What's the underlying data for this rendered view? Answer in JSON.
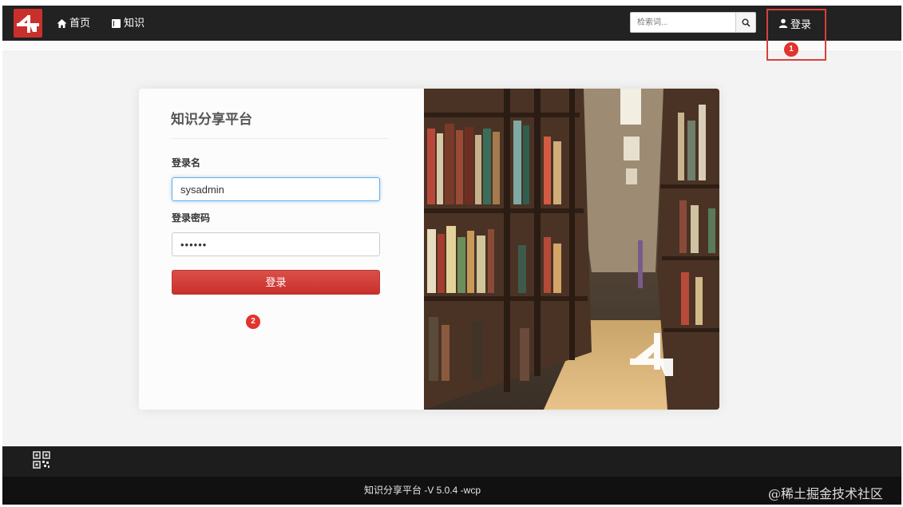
{
  "navbar": {
    "home_label": "首页",
    "knowledge_label": "知识",
    "search_placeholder": "检索词...",
    "login_label": "登录"
  },
  "annotations": {
    "step1": "1",
    "step2": "2"
  },
  "login_form": {
    "title": "知识分享平台",
    "username_label": "登录名",
    "username_value": "sysadmin",
    "password_label": "登录密码",
    "password_value": "••••••",
    "submit_label": "登录"
  },
  "footer": {
    "version_text": "知识分享平台 -V 5.0.4 -wcp",
    "watermark": "@稀土掘金技术社区"
  },
  "colors": {
    "brand_red": "#c9302c",
    "navbar_bg": "#222222",
    "footer_bg": "#111111",
    "annotation_red": "#e2332c"
  },
  "icons": [
    "logo-icon",
    "home-icon",
    "book-icon",
    "search-icon",
    "user-icon",
    "qr-code-icon"
  ]
}
